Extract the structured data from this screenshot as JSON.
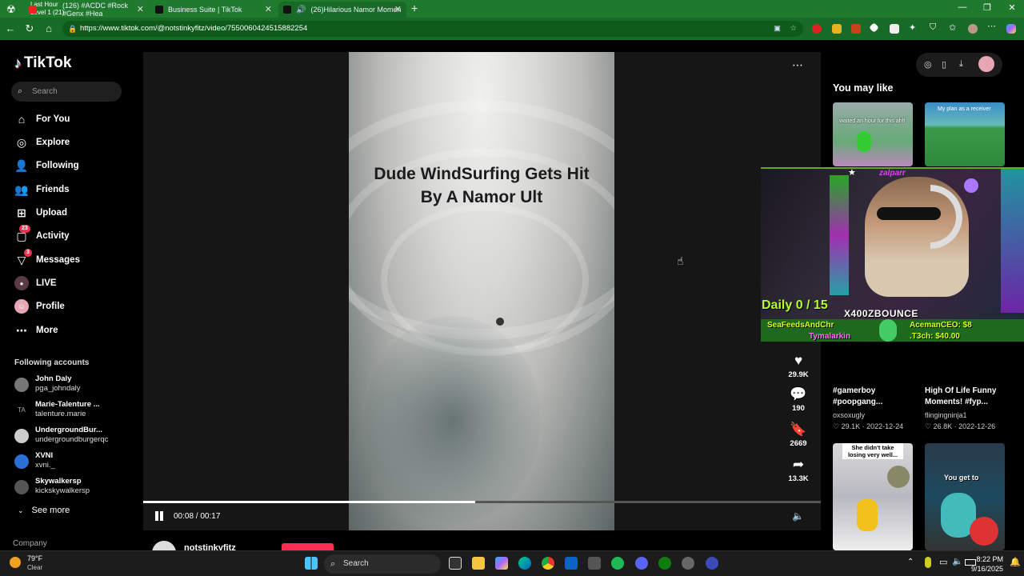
{
  "browser": {
    "tabs": [
      {
        "label": "(126) #ACDC #Rock #Genx #Hea"
      },
      {
        "label": "Business Suite | TikTok"
      },
      {
        "label": "(26)Hilarious Namor Momen"
      }
    ],
    "overlay_text_1": "Last Hour",
    "overlay_text_2": "Level 1  (21)",
    "url": "https://www.tiktok.com/@notstinkyfitz/video/7550060424515882254"
  },
  "sidebar": {
    "logo": "TikTok",
    "search_placeholder": "Search",
    "nav": [
      {
        "label": "For You",
        "icon": "home-icon"
      },
      {
        "label": "Explore",
        "icon": "compass-icon"
      },
      {
        "label": "Following",
        "icon": "user-follow-icon"
      },
      {
        "label": "Friends",
        "icon": "friends-icon"
      },
      {
        "label": "Upload",
        "icon": "plus-square-icon"
      },
      {
        "label": "Activity",
        "icon": "message-icon",
        "badge": "23"
      },
      {
        "label": "Messages",
        "icon": "send-icon",
        "badge": "3"
      },
      {
        "label": "LIVE",
        "icon": "live-icon"
      },
      {
        "label": "Profile",
        "icon": "profile-icon"
      },
      {
        "label": "More",
        "icon": "more-icon"
      }
    ],
    "following_header": "Following accounts",
    "accounts": [
      {
        "name": "John Daly",
        "handle": "pga_johndaly"
      },
      {
        "name": "Marie-Talenture ...",
        "handle": "talenture.marie"
      },
      {
        "name": "UndergroundBur...",
        "handle": "undergroundburgerqc"
      },
      {
        "name": "XVNI",
        "handle": "xvni._"
      },
      {
        "name": "Skywalkersp",
        "handle": "kickskywalkersp"
      }
    ],
    "see_more": "See more",
    "company": "Company"
  },
  "video": {
    "caption": "Dude WindSurfing Gets Hit By A Namor Ult",
    "time": "00:08 / 00:17",
    "progress": 0.49,
    "author": "notstinkyfitz",
    "actions": {
      "likes": "29.9K",
      "comments": "190",
      "saves": "2669",
      "shares": "13.3K"
    }
  },
  "recommendations": {
    "header": "You may like",
    "items": [
      {
        "thumb_text": "waited an hour for this ahh"
      },
      {
        "thumb_text": "My plan as a receiver"
      },
      {
        "title": "#gamerboy #poopgang...",
        "user": "oxsoxugly",
        "likes": "29.1K",
        "date": "2022-12-24"
      },
      {
        "title": "High Of Life Funny Moments! #fyp...",
        "user": "flingingninja1",
        "likes": "26.8K",
        "date": "2022-12-26"
      },
      {
        "thumb_text": "She didn't take losing very well..."
      },
      {
        "thumb_text": "You get to"
      }
    ]
  },
  "stream_overlay": {
    "top_name": "zalparr",
    "daily": "Daily 0 / 15",
    "streamer": "X400ZBOUNCE",
    "ticker_1": "SeaFeedsAndChr",
    "ticker_2": "AcemanCEO: $8",
    "ticker_3": "Tymalarkin",
    "ticker_4": ".T3ch: $40.00"
  },
  "taskbar": {
    "temp": "79°F",
    "condition": "Clear",
    "search": "Search",
    "time": "8:22 PM",
    "date": "9/16/2025"
  }
}
